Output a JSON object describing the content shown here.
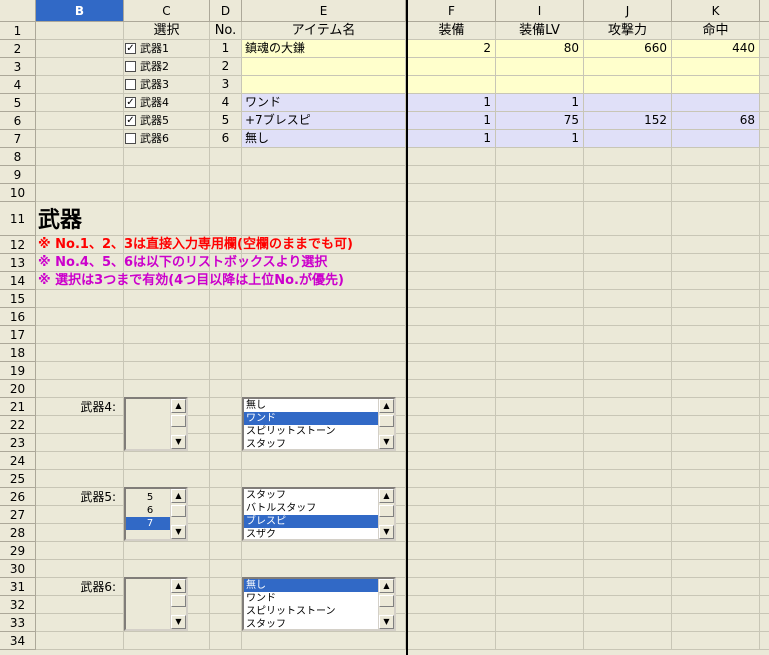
{
  "columns": {
    "B": "B",
    "C": "C",
    "D": "D",
    "E": "E",
    "F": "F",
    "I": "I",
    "J": "J",
    "K": "K"
  },
  "headers": {
    "select": "選択",
    "no": "No.",
    "item": "アイテム名",
    "equip": "装備",
    "equip_lv": "装備LV",
    "attack": "攻撃力",
    "hit": "命中"
  },
  "rows": [
    {
      "chk": true,
      "label": "武器1",
      "no": "1",
      "item": "鎮魂の大鎌",
      "equip": "2",
      "lv": "80",
      "atk": "660",
      "hit": "440"
    },
    {
      "chk": false,
      "label": "武器2",
      "no": "2",
      "item": "",
      "equip": "",
      "lv": "",
      "atk": "",
      "hit": ""
    },
    {
      "chk": false,
      "label": "武器3",
      "no": "3",
      "item": "",
      "equip": "",
      "lv": "",
      "atk": "",
      "hit": ""
    },
    {
      "chk": true,
      "label": "武器4",
      "no": "4",
      "item": "ワンド",
      "equip": "1",
      "lv": "1",
      "atk": "",
      "hit": ""
    },
    {
      "chk": true,
      "label": "武器5",
      "no": "5",
      "item": "+7ブレスピ",
      "equip": "1",
      "lv": "75",
      "atk": "152",
      "hit": "68"
    },
    {
      "chk": false,
      "label": "武器6",
      "no": "6",
      "item": "無し",
      "equip": "1",
      "lv": "1",
      "atk": "",
      "hit": ""
    }
  ],
  "section_title": "武器",
  "notes": [
    {
      "text": "※ No.1、2、3は直接入力専用欄(空欄のままでも可)",
      "color": "#ff0000"
    },
    {
      "text": "※ No.4、5、6は以下のリストボックスより選択",
      "color": "#cc00cc"
    },
    {
      "text": "※ 選択は3つまで有効(4つ目以降は上位No.が優先)",
      "color": "#cc00cc"
    }
  ],
  "selectors": [
    {
      "label": "武器4:",
      "nums": [],
      "num_sel": -1,
      "items": [
        "無し",
        "ワンド",
        "スピリットストーン",
        "スタッフ"
      ],
      "item_sel": 1
    },
    {
      "label": "武器5:",
      "nums": [
        "5",
        "6",
        "7"
      ],
      "num_sel": 2,
      "items": [
        "スタッフ",
        "バトルスタッフ",
        "ブレスピ",
        "スザク"
      ],
      "item_sel": 2
    },
    {
      "label": "武器6:",
      "nums": [],
      "num_sel": -1,
      "items": [
        "無し",
        "ワンド",
        "スピリットストーン",
        "スタッフ"
      ],
      "item_sel": 0
    }
  ],
  "row_numbers": [
    "1",
    "2",
    "3",
    "4",
    "5",
    "6",
    "7",
    "8",
    "9",
    "10",
    "11",
    "12",
    "13",
    "14",
    "15",
    "16",
    "17",
    "18",
    "19",
    "20",
    "21",
    "22",
    "23",
    "24",
    "25",
    "26",
    "27",
    "28",
    "29",
    "30",
    "31",
    "32",
    "33",
    "34"
  ],
  "colors": {
    "selected_col": "#3169c6",
    "yellow_fill": "#ffffcc",
    "lavender_fill": "#e0e0f8",
    "highlight": "#3169c6"
  }
}
